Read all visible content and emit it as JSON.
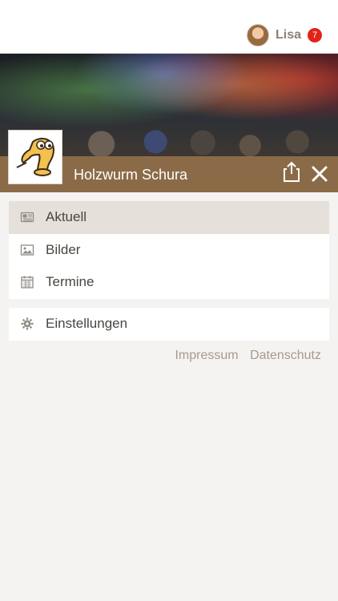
{
  "header": {
    "user_name": "Lisa",
    "notification_count": "7"
  },
  "club": {
    "name": "Holzwurm Schura"
  },
  "menu": {
    "items": [
      {
        "label": "Aktuell",
        "icon": "newspaper-icon",
        "active": true
      },
      {
        "label": "Bilder",
        "icon": "image-icon",
        "active": false
      },
      {
        "label": "Termine",
        "icon": "calendar-icon",
        "active": false
      }
    ],
    "settings": {
      "label": "Einstellungen",
      "icon": "gear-icon"
    }
  },
  "footer_links": {
    "impressum": "Impressum",
    "datenschutz": "Datenschutz"
  },
  "colors": {
    "accent_brown": "#8b6b47",
    "badge_red": "#e2231a",
    "active_item_bg": "#e5e0d9"
  }
}
